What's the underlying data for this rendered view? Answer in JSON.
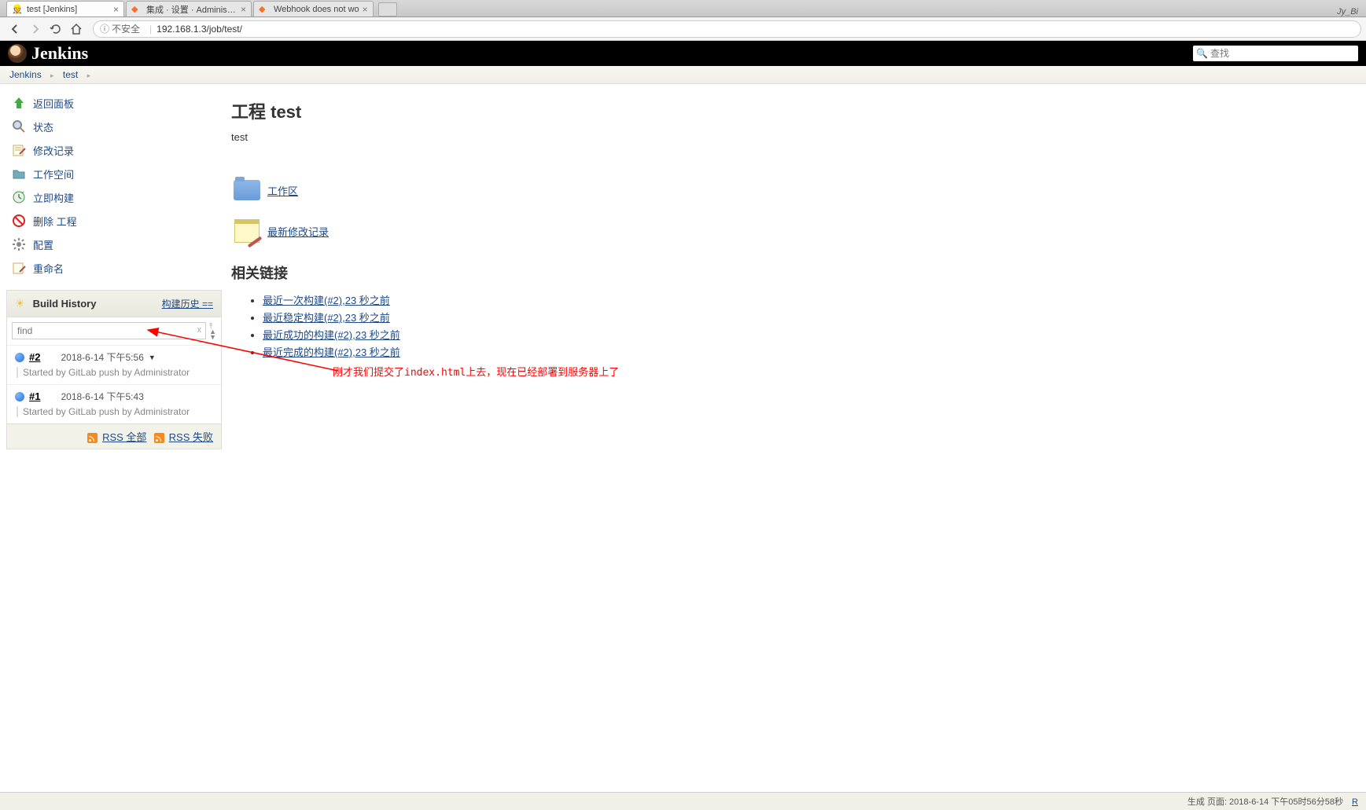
{
  "browser": {
    "tabs": [
      {
        "title": "test [Jenkins]",
        "favicon": "jenkins",
        "active": true
      },
      {
        "title": "集成 · 设置 · Administrat",
        "favicon": "gitlab",
        "active": false
      },
      {
        "title": "Webhook does not wo",
        "favicon": "gitlab",
        "active": false
      }
    ],
    "user_badge": "Jy_Bi",
    "url_insecure_label": "不安全",
    "url": "192.168.1.3/job/test/",
    "info_icon": "ⓘ"
  },
  "header": {
    "logo_text": "Jenkins",
    "search_placeholder": "查找"
  },
  "breadcrumb": {
    "items": [
      "Jenkins",
      "test"
    ]
  },
  "sidebar": {
    "tasks": [
      {
        "label": "返回面板",
        "icon": "up-arrow",
        "name": "back-to-dashboard"
      },
      {
        "label": "状态",
        "icon": "magnifier",
        "name": "status"
      },
      {
        "label": "修改记录",
        "icon": "notepad",
        "name": "changes"
      },
      {
        "label": "工作空间",
        "icon": "folder",
        "name": "workspace"
      },
      {
        "label": "立即构建",
        "icon": "clock",
        "name": "build-now"
      },
      {
        "label": "删除 工程",
        "icon": "delete",
        "name": "delete-project"
      },
      {
        "label": "配置",
        "icon": "gear",
        "name": "configure"
      },
      {
        "label": "重命名",
        "icon": "rename",
        "name": "rename"
      }
    ],
    "build_history": {
      "title": "Build History",
      "trend_label": "构建历史 ==",
      "filter_placeholder": "find",
      "builds": [
        {
          "num": "#2",
          "date": "2018-6-14 下午5:56",
          "cause": "Started by GitLab push by Administrator",
          "has_dropdown": true
        },
        {
          "num": "#1",
          "date": "2018-6-14 下午5:43",
          "cause": "Started by GitLab push by Administrator",
          "has_dropdown": false
        }
      ],
      "rss_all": "RSS 全部",
      "rss_fail": "RSS 失败"
    }
  },
  "main": {
    "title": "工程 test",
    "description": "test",
    "workspace_link": "工作区",
    "changes_link": "最新修改记录",
    "related_heading": "相关链接",
    "related_links": [
      "最近一次构建(#2),23 秒之前",
      "最近稳定构建(#2),23 秒之前",
      "最近成功的构建(#2),23 秒之前",
      "最近完成的构建(#2),23 秒之前"
    ]
  },
  "annotation": {
    "text": "刚才我们提交了index.html上去，现在已经部署到服务器上了"
  },
  "footer": {
    "text": "生成 页面: 2018-6-14 下午05时56分58秒",
    "rest_link": "R"
  }
}
